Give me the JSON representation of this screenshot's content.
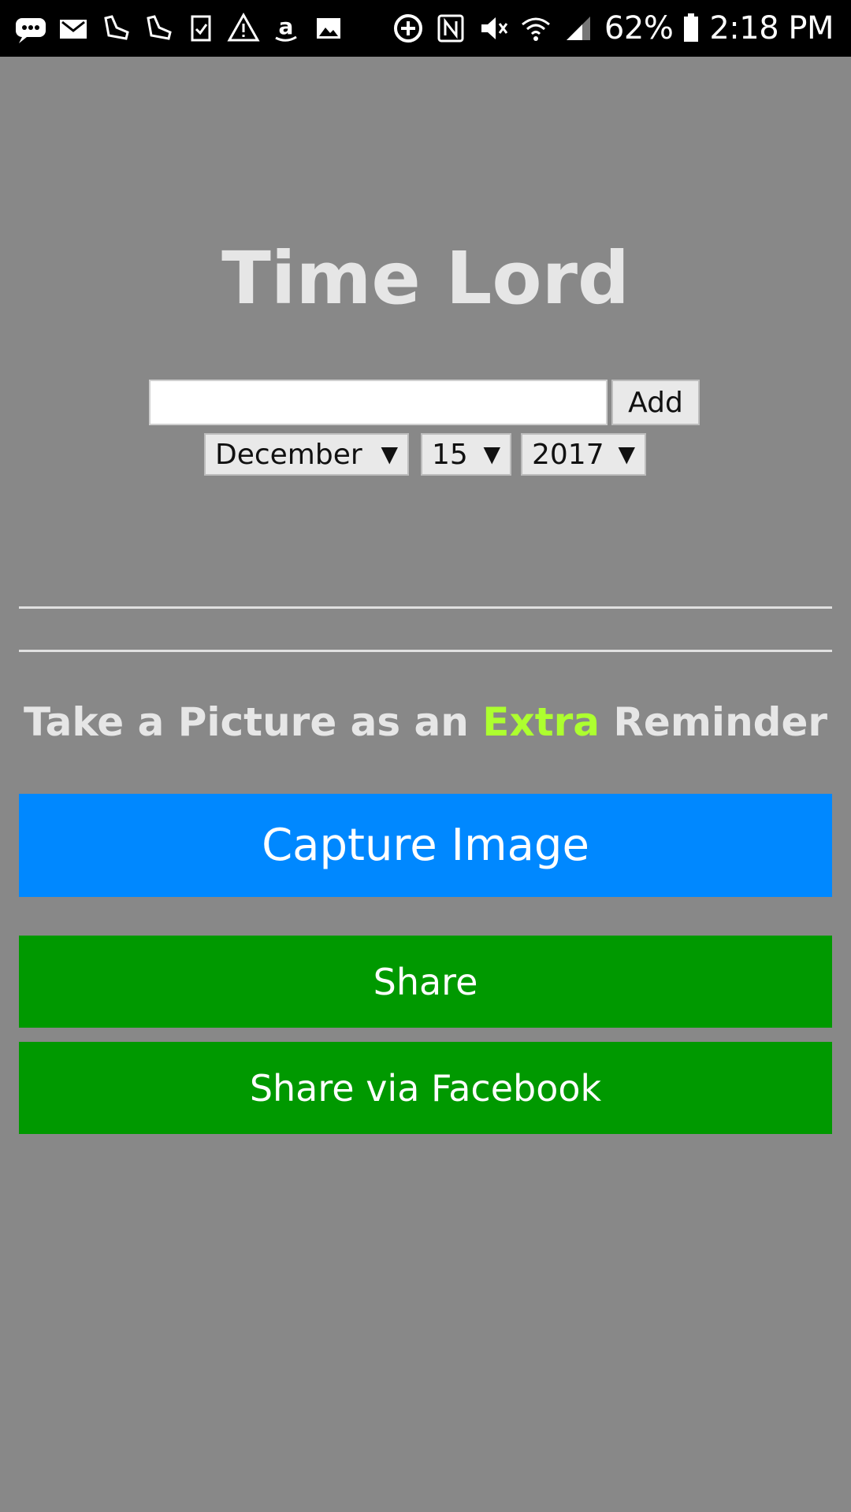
{
  "status_bar": {
    "left_icons": [
      "messages-icon",
      "gmail-icon",
      "fitness-shoe-icon",
      "fitness-shoe-icon",
      "clipboard-check-icon",
      "warning-icon",
      "amazon-icon",
      "image-icon"
    ],
    "right_icons": [
      "add-circle-icon",
      "nfc-icon",
      "vibrate-mute-icon",
      "wifi-icon",
      "signal-icon",
      "battery-icon"
    ],
    "battery_percent": "62%",
    "time": "2:18 PM"
  },
  "app": {
    "title": "Time Lord",
    "task_input": {
      "value": "",
      "placeholder": ""
    },
    "add_label": "Add",
    "date": {
      "month": "December",
      "day": "15",
      "year": "2017"
    },
    "dropdown_arrow": "▼",
    "reminder_text": {
      "before": "Take a Picture as an ",
      "highlight": "Extra",
      "after": " Reminder"
    },
    "capture_label": "Capture Image",
    "share_label": "Share",
    "share_facebook_label": "Share via Facebook"
  },
  "colors": {
    "background": "#888888",
    "title_text": "#e6e6e6",
    "highlight": "#adff2f",
    "capture_button": "#0088ff",
    "share_button": "#009900"
  }
}
